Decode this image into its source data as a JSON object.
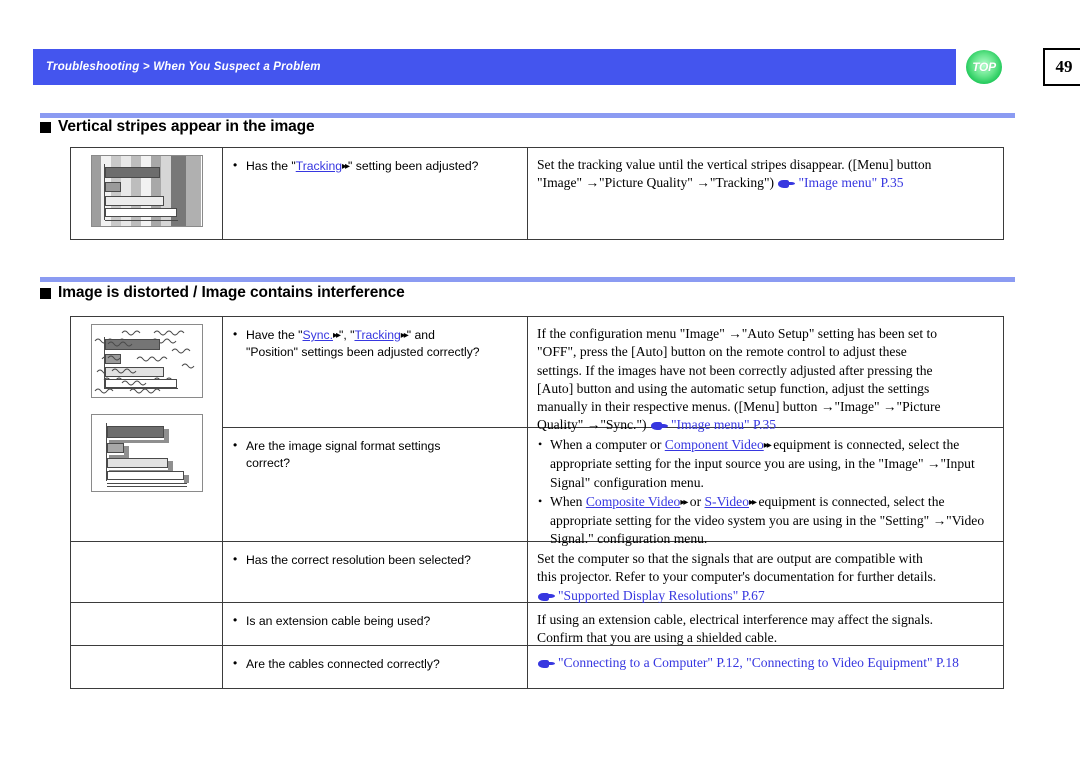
{
  "header": {
    "breadcrumb": "Troubleshooting > When You Suspect a Problem",
    "top_button_label": "TOP",
    "page_number": "49",
    "bar_color": "#4455ee",
    "top_button_color": "#21c95a"
  },
  "sections": [
    {
      "heading": "Vertical stripes appear in the image",
      "rows": [
        {
          "illustration": "vertical-stripes-image",
          "questions": [
            {
              "pre": "Has the \"",
              "link": "Tracking",
              "post": "\" setting been adjusted?"
            }
          ],
          "answer_lines": [
            "Set the tracking value until the vertical stripes disappear. ([Menu] button",
            "\"Image\" →\"Picture Quality\" →\"Tracking\")"
          ],
          "answer_ref": "\"Image menu\" P.35"
        }
      ]
    },
    {
      "heading": "Image is distorted / Image contains interference",
      "rows": [
        {
          "illustration": "wavy-interference-image",
          "questions": [
            {
              "pre": "Have the \"",
              "link": "Sync.",
              "mid": "\", \"",
              "link2": "Tracking",
              "post": "\" and",
              "line2": "\"Position\" settings been adjusted correctly?"
            }
          ],
          "answer_lines": [
            "If the configuration menu \"Image\" →\"Auto Setup\" setting has been set to",
            "\"OFF\", press the [Auto] button on the remote control to adjust these",
            "settings. If the images have not been correctly adjusted after pressing the",
            "[Auto] button and using the automatic setup function, adjust the settings",
            "manually in their respective menus. ([Menu] button →\"Image\" →\"Picture",
            "Quality\" →\"Sync.\")"
          ],
          "answer_ref": "\"Image menu\" P.35"
        },
        {
          "illustration": "ghosting-image",
          "questions": [
            {
              "line1": "Are the image signal format settings",
              "line2": "correct?"
            }
          ],
          "answer_bullets": [
            {
              "pre": "When a computer or ",
              "link": "Component Video",
              "post": " equipment is connected, select the appropriate setting for the input source you are using, in the \"Image\" →\"Input Signal\" configuration menu."
            },
            {
              "pre": "When ",
              "link": "Composite Video",
              "mid": " or ",
              "link2": "S-Video",
              "post": " equipment is connected, select the appropriate setting for the video system you are using in the \"Setting\" →\"Video Signal.\" configuration menu."
            }
          ]
        },
        {
          "questions": [
            {
              "line1": "Has the correct resolution been selected?"
            }
          ],
          "answer_lines": [
            "Set the computer so that the signals that are output are compatible with",
            "this projector. Refer to your computer's documentation for further details."
          ],
          "answer_ref": "\"Supported Display Resolutions\" P.67"
        },
        {
          "questions": [
            {
              "line1": "Is an extension cable being used?"
            }
          ],
          "answer_lines": [
            "If using an extension cable, electrical interference may affect the signals.",
            "Confirm that you are using a shielded cable."
          ]
        },
        {
          "questions": [
            {
              "line1": "Are the cables connected correctly?"
            }
          ],
          "answer_ref_only": "\"Connecting to a Computer\" P.12, \"Connecting to Video Equipment\" P.18"
        }
      ]
    }
  ],
  "glyphs": {
    "gloss_mark": "▸▸",
    "arrow": "→"
  }
}
